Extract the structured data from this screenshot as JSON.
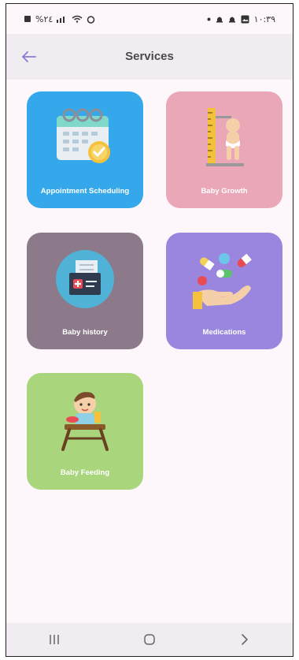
{
  "status_bar": {
    "left_text": "%٢٤",
    "time": "١٠:٣٩"
  },
  "header": {
    "title": "Services"
  },
  "services": [
    {
      "label": "Appointment Scheduling",
      "color": "#34a8ea",
      "icon": "calendar-icon"
    },
    {
      "label": "Baby Growth",
      "color": "#e9a7b8",
      "icon": "baby-height-icon"
    },
    {
      "label": "Baby history",
      "color": "#8c7a8a",
      "icon": "medical-folder-icon"
    },
    {
      "label": "Medications",
      "color": "#9a86de",
      "icon": "pills-hand-icon"
    },
    {
      "label": "Baby Feeding",
      "color": "#a9d57c",
      "icon": "baby-highchair-icon"
    }
  ],
  "colors": {
    "background": "#fdf7fb",
    "appbar": "#f1ecf2",
    "accent": "#8d7bd8"
  }
}
